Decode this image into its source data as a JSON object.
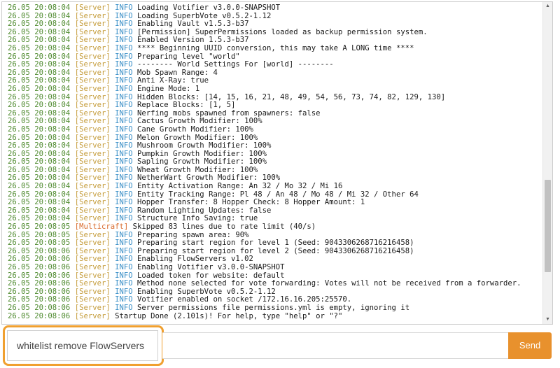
{
  "console": {
    "lines": [
      {
        "time": "26.05 20:08:04",
        "source": "[Server]",
        "level": "INFO",
        "message": "Loading Votifier v3.0.0-SNAPSHOT"
      },
      {
        "time": "26.05 20:08:04",
        "source": "[Server]",
        "level": "INFO",
        "message": "Loading SuperbVote v0.5.2-1.12"
      },
      {
        "time": "26.05 20:08:04",
        "source": "[Server]",
        "level": "INFO",
        "message": "Enabling Vault v1.5.3-b37"
      },
      {
        "time": "26.05 20:08:04",
        "source": "[Server]",
        "level": "INFO",
        "message": "[Permission] SuperPermissions loaded as backup permission system."
      },
      {
        "time": "26.05 20:08:04",
        "source": "[Server]",
        "level": "INFO",
        "message": "Enabled Version 1.5.3-b37"
      },
      {
        "time": "26.05 20:08:04",
        "source": "[Server]",
        "level": "INFO",
        "message": "**** Beginning UUID conversion, this may take A LONG time ****"
      },
      {
        "time": "26.05 20:08:04",
        "source": "[Server]",
        "level": "INFO",
        "message": "Preparing level \"world\""
      },
      {
        "time": "26.05 20:08:04",
        "source": "[Server]",
        "level": "INFO",
        "message": "-------- World Settings For [world] --------"
      },
      {
        "time": "26.05 20:08:04",
        "source": "[Server]",
        "level": "INFO",
        "message": "Mob Spawn Range: 4"
      },
      {
        "time": "26.05 20:08:04",
        "source": "[Server]",
        "level": "INFO",
        "message": "Anti X-Ray: true"
      },
      {
        "time": "26.05 20:08:04",
        "source": "[Server]",
        "level": "INFO",
        "message": "Engine Mode: 1"
      },
      {
        "time": "26.05 20:08:04",
        "source": "[Server]",
        "level": "INFO",
        "message": "Hidden Blocks: [14, 15, 16, 21, 48, 49, 54, 56, 73, 74, 82, 129, 130]"
      },
      {
        "time": "26.05 20:08:04",
        "source": "[Server]",
        "level": "INFO",
        "message": "Replace Blocks: [1, 5]"
      },
      {
        "time": "26.05 20:08:04",
        "source": "[Server]",
        "level": "INFO",
        "message": "Nerfing mobs spawned from spawners: false"
      },
      {
        "time": "26.05 20:08:04",
        "source": "[Server]",
        "level": "INFO",
        "message": "Cactus Growth Modifier: 100%"
      },
      {
        "time": "26.05 20:08:04",
        "source": "[Server]",
        "level": "INFO",
        "message": "Cane Growth Modifier: 100%"
      },
      {
        "time": "26.05 20:08:04",
        "source": "[Server]",
        "level": "INFO",
        "message": "Melon Growth Modifier: 100%"
      },
      {
        "time": "26.05 20:08:04",
        "source": "[Server]",
        "level": "INFO",
        "message": "Mushroom Growth Modifier: 100%"
      },
      {
        "time": "26.05 20:08:04",
        "source": "[Server]",
        "level": "INFO",
        "message": "Pumpkin Growth Modifier: 100%"
      },
      {
        "time": "26.05 20:08:04",
        "source": "[Server]",
        "level": "INFO",
        "message": "Sapling Growth Modifier: 100%"
      },
      {
        "time": "26.05 20:08:04",
        "source": "[Server]",
        "level": "INFO",
        "message": "Wheat Growth Modifier: 100%"
      },
      {
        "time": "26.05 20:08:04",
        "source": "[Server]",
        "level": "INFO",
        "message": "NetherWart Growth Modifier: 100%"
      },
      {
        "time": "26.05 20:08:04",
        "source": "[Server]",
        "level": "INFO",
        "message": "Entity Activation Range: An 32 / Mo 32 / Mi 16"
      },
      {
        "time": "26.05 20:08:04",
        "source": "[Server]",
        "level": "INFO",
        "message": "Entity Tracking Range: Pl 48 / An 48 / Mo 48 / Mi 32 / Other 64"
      },
      {
        "time": "26.05 20:08:04",
        "source": "[Server]",
        "level": "INFO",
        "message": "Hopper Transfer: 8 Hopper Check: 8 Hopper Amount: 1"
      },
      {
        "time": "26.05 20:08:04",
        "source": "[Server]",
        "level": "INFO",
        "message": "Random Lighting Updates: false"
      },
      {
        "time": "26.05 20:08:04",
        "source": "[Server]",
        "level": "INFO",
        "message": "Structure Info Saving: true"
      },
      {
        "time": "26.05 20:08:05",
        "source": "[Multicraft]",
        "level": "",
        "message": "Skipped 83 lines due to rate limit (40/s)"
      },
      {
        "time": "26.05 20:08:05",
        "source": "[Server]",
        "level": "INFO",
        "message": "Preparing spawn area: 90%"
      },
      {
        "time": "26.05 20:08:05",
        "source": "[Server]",
        "level": "INFO",
        "message": "Preparing start region for level 1 (Seed: 9043306268716216458)"
      },
      {
        "time": "26.05 20:08:06",
        "source": "[Server]",
        "level": "INFO",
        "message": "Preparing start region for level 2 (Seed: 9043306268716216458)"
      },
      {
        "time": "26.05 20:08:06",
        "source": "[Server]",
        "level": "INFO",
        "message": "Enabling FlowServers v1.02"
      },
      {
        "time": "26.05 20:08:06",
        "source": "[Server]",
        "level": "INFO",
        "message": "Enabling Votifier v3.0.0-SNAPSHOT"
      },
      {
        "time": "26.05 20:08:06",
        "source": "[Server]",
        "level": "INFO",
        "message": "Loaded token for website: default"
      },
      {
        "time": "26.05 20:08:06",
        "source": "[Server]",
        "level": "INFO",
        "message": "Method none selected for vote forwarding: Votes will not be received from a forwarder."
      },
      {
        "time": "26.05 20:08:06",
        "source": "[Server]",
        "level": "INFO",
        "message": "Enabling SuperbVote v0.5.2-1.12"
      },
      {
        "time": "26.05 20:08:06",
        "source": "[Server]",
        "level": "INFO",
        "message": "Votifier enabled on socket /172.16.16.205:25570."
      },
      {
        "time": "26.05 20:08:06",
        "source": "[Server]",
        "level": "INFO",
        "message": "Server permissions file permissions.yml is empty, ignoring it"
      },
      {
        "time": "26.05 20:08:06",
        "source": "[Server]",
        "level": "",
        "message": "Startup Done (2.101s)! For help, type \"help\" or \"?\""
      }
    ]
  },
  "command": {
    "value": "whitelist remove FlowServers",
    "send_label": "Send"
  },
  "colors": {
    "timestamp": "#4e8a2e",
    "server_tag": "#c59d3c",
    "multicraft_tag": "#d8692a",
    "info_level": "#3a8fc7",
    "send_button": "#e8912d",
    "focus_ring": "#f0a030"
  },
  "icons": {
    "scroll_up": "scroll-up-arrow-icon",
    "scroll_down": "scroll-down-arrow-icon"
  }
}
